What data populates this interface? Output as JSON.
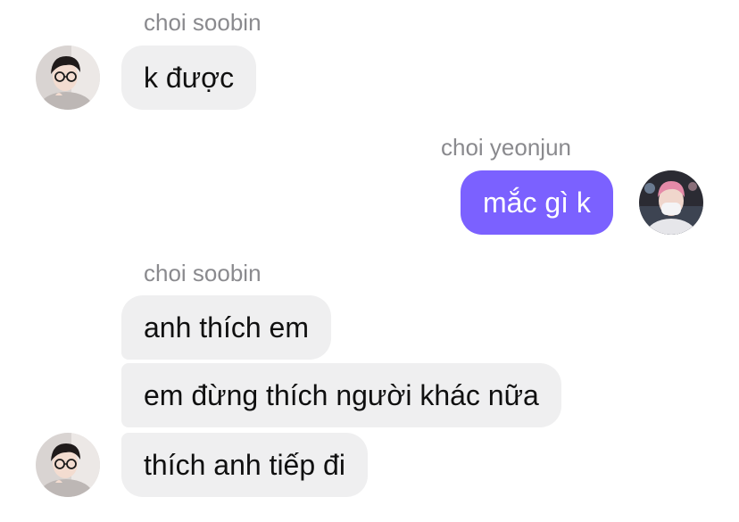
{
  "chat": {
    "groups": [
      {
        "sender": "choi soobin",
        "messages": [
          "k được"
        ]
      },
      {
        "sender": "choi yeonjun",
        "messages": [
          "mắc gì k"
        ]
      },
      {
        "sender": "choi soobin",
        "messages": [
          "anh thích em",
          "em đừng thích người khác nữa",
          "thích anh tiếp đi"
        ]
      }
    ]
  },
  "colors": {
    "incoming_bubble": "#efeff0",
    "outgoing_bubble": "#7b61ff",
    "sender_name": "#8a8a8e"
  }
}
